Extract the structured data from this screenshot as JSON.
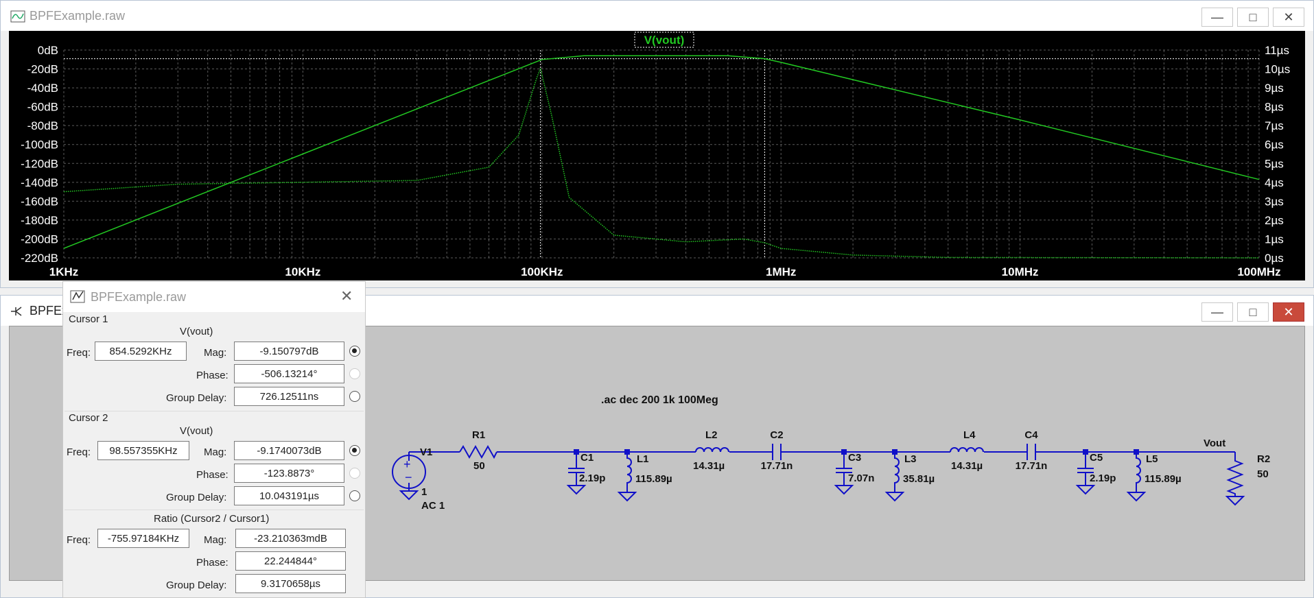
{
  "plot_window": {
    "title": "BPFExample.raw",
    "trace_label": "V(vout)",
    "colors": {
      "trace": "#22c822",
      "background": "#000000",
      "axis_text": "#ffffff",
      "grid": "#5a5a5a"
    },
    "y_left_ticks": [
      "0dB",
      "-20dB",
      "-40dB",
      "-60dB",
      "-80dB",
      "-100dB",
      "-120dB",
      "-140dB",
      "-160dB",
      "-180dB",
      "-200dB",
      "-220dB"
    ],
    "y_right_ticks": [
      "11µs",
      "10µs",
      "9µs",
      "8µs",
      "7µs",
      "6µs",
      "5µs",
      "4µs",
      "3µs",
      "2µs",
      "1µs",
      "0µs"
    ],
    "x_ticks": [
      "1KHz",
      "10KHz",
      "100KHz",
      "1MHz",
      "10MHz",
      "100MHz"
    ]
  },
  "chart_data": {
    "type": "line",
    "x_scale": "log",
    "xlim": [
      1000,
      100000000
    ],
    "ylim": [
      -220,
      0
    ],
    "y2lim": [
      0,
      11
    ],
    "grid": true,
    "series": [
      {
        "name": "V(vout)",
        "axis": "left",
        "line": "solid",
        "x": [
          1000,
          10000,
          100000,
          150000,
          300000,
          600000,
          854529,
          1000000,
          10000000,
          100000000
        ],
        "y": [
          -210,
          -110,
          -10,
          -6,
          -6,
          -6,
          -9.15,
          -13,
          -74,
          -137
        ]
      },
      {
        "axis": "right",
        "line": "dotted",
        "x": [
          1000,
          3000,
          10000,
          30000,
          60000,
          80000,
          95000,
          98557,
          110000,
          130000,
          200000,
          400000,
          700000,
          854529,
          1000000,
          2000000,
          5000000,
          100000000
        ],
        "y": [
          3.5,
          3.9,
          4.0,
          4.1,
          4.8,
          6.5,
          9.5,
          10.04,
          7.5,
          3.2,
          1.2,
          0.85,
          1.0,
          0.8,
          0.5,
          0.15,
          0.02,
          0.0
        ]
      }
    ],
    "cursors": [
      854529.2,
      98557.355
    ]
  },
  "schematic_window": {
    "title": "BPFExa",
    "directive": ".ac dec 200 1k 100Meg",
    "colors": {
      "wire": "#1010c8",
      "node": "#1010c8",
      "background": "#c4c4c4"
    },
    "labels": {
      "v1": "V1",
      "v1_val": "1",
      "v1_ac": "AC 1",
      "r1": "R1",
      "r1_val": "50",
      "c1": "C1",
      "c1_val": "2.19p",
      "l1": "L1",
      "l1_val": "115.89µ",
      "l2": "L2",
      "l2_val": "14.31µ",
      "c2": "C2",
      "c2_val": "17.71n",
      "c3": "C3",
      "c3_val": "7.07n",
      "l3": "L3",
      "l3_val": "35.81µ",
      "l4": "L4",
      "l4_val": "14.31µ",
      "c4": "C4",
      "c4_val": "17.71n",
      "c5": "C5",
      "c5_val": "2.19p",
      "l5": "L5",
      "l5_val": "115.89µ",
      "vout": "Vout",
      "r2": "R2",
      "r2_val": "50"
    }
  },
  "cursor_window": {
    "title": "BPFExample.raw",
    "cursor1": {
      "header": "Cursor 1",
      "trace": "V(vout)",
      "freq_label": "Freq:",
      "freq": "854.5292KHz",
      "mag_label": "Mag:",
      "mag": "-9.150797dB",
      "phase_label": "Phase:",
      "phase": "-506.13214°",
      "gd_label": "Group Delay:",
      "gd": "726.12511ns"
    },
    "cursor2": {
      "header": "Cursor 2",
      "trace": "V(vout)",
      "freq_label": "Freq:",
      "freq": "98.557355KHz",
      "mag_label": "Mag:",
      "mag": "-9.1740073dB",
      "phase_label": "Phase:",
      "phase": "-123.8873°",
      "gd_label": "Group Delay:",
      "gd": "10.043191µs"
    },
    "ratio": {
      "header": "Ratio (Cursor2 / Cursor1)",
      "freq_label": "Freq:",
      "freq": "-755.97184KHz",
      "mag_label": "Mag:",
      "mag": "-23.210363mdB",
      "phase_label": "Phase:",
      "phase": "22.244844°",
      "gd_label": "Group Delay:",
      "gd": "9.3170658µs"
    }
  }
}
